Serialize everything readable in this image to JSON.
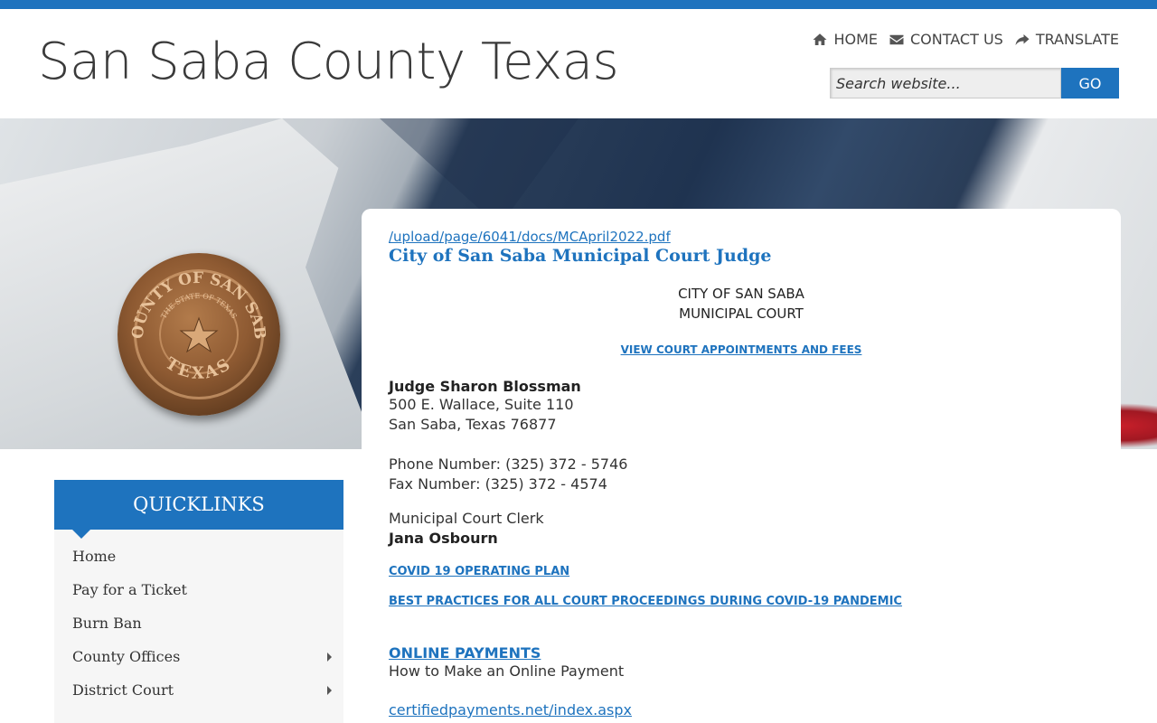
{
  "header": {
    "site_title": "San Saba County Texas",
    "nav": [
      {
        "label": "HOME",
        "icon": "home-icon"
      },
      {
        "label": "CONTACT US",
        "icon": "envelope-icon"
      },
      {
        "label": "TRANSLATE",
        "icon": "share-arrow-icon"
      }
    ],
    "search": {
      "placeholder": "Search website...",
      "button_label": "GO"
    }
  },
  "seal": {
    "top_text": "COUNTY OF SAN SABA",
    "middle_text": "THE STATE OF TEXAS",
    "bottom_text": "TEXAS"
  },
  "content": {
    "pdf_link": "/upload/page/6041/docs/MCApril2022.pdf",
    "heading": "City of San Saba Municipal Court Judge",
    "court_line1": "CITY OF SAN SABA",
    "court_line2": "MUNICIPAL COURT",
    "appointments_link": "VIEW COURT APPOINTMENTS AND FEES",
    "judge_name": "Judge Sharon Blossman",
    "address_line1": "500 E. Wallace, Suite 110",
    "address_line2": "San Saba, Texas 76877",
    "phone": "Phone Number: (325) 372 - 5746",
    "fax": "Fax Number: (325) 372 - 4574",
    "clerk_title": "Municipal Court Clerk",
    "clerk_name": "Jana Osbourn",
    "covid_plan_link": "COVID 19 OPERATING PLAN",
    "best_practices_link": "BEST PRACTICES FOR ALL COURT PROCEEDINGS DURING COVID-19 PANDEMIC",
    "payments_link": "ONLINE PAYMENTS",
    "payments_desc": "How to Make an Online Payment",
    "cert_link": "certifiedpayments.net/index.aspx"
  },
  "quicklinks": {
    "title": "QUICKLINKS",
    "items": [
      {
        "label": "Home",
        "has_submenu": false
      },
      {
        "label": "Pay for a Ticket",
        "has_submenu": false
      },
      {
        "label": "Burn Ban",
        "has_submenu": false
      },
      {
        "label": "County Offices",
        "has_submenu": true
      },
      {
        "label": "District Court",
        "has_submenu": true
      }
    ]
  },
  "colors": {
    "accent": "#1e73be",
    "text": "#333333",
    "flag_red": "#c81f2a"
  }
}
